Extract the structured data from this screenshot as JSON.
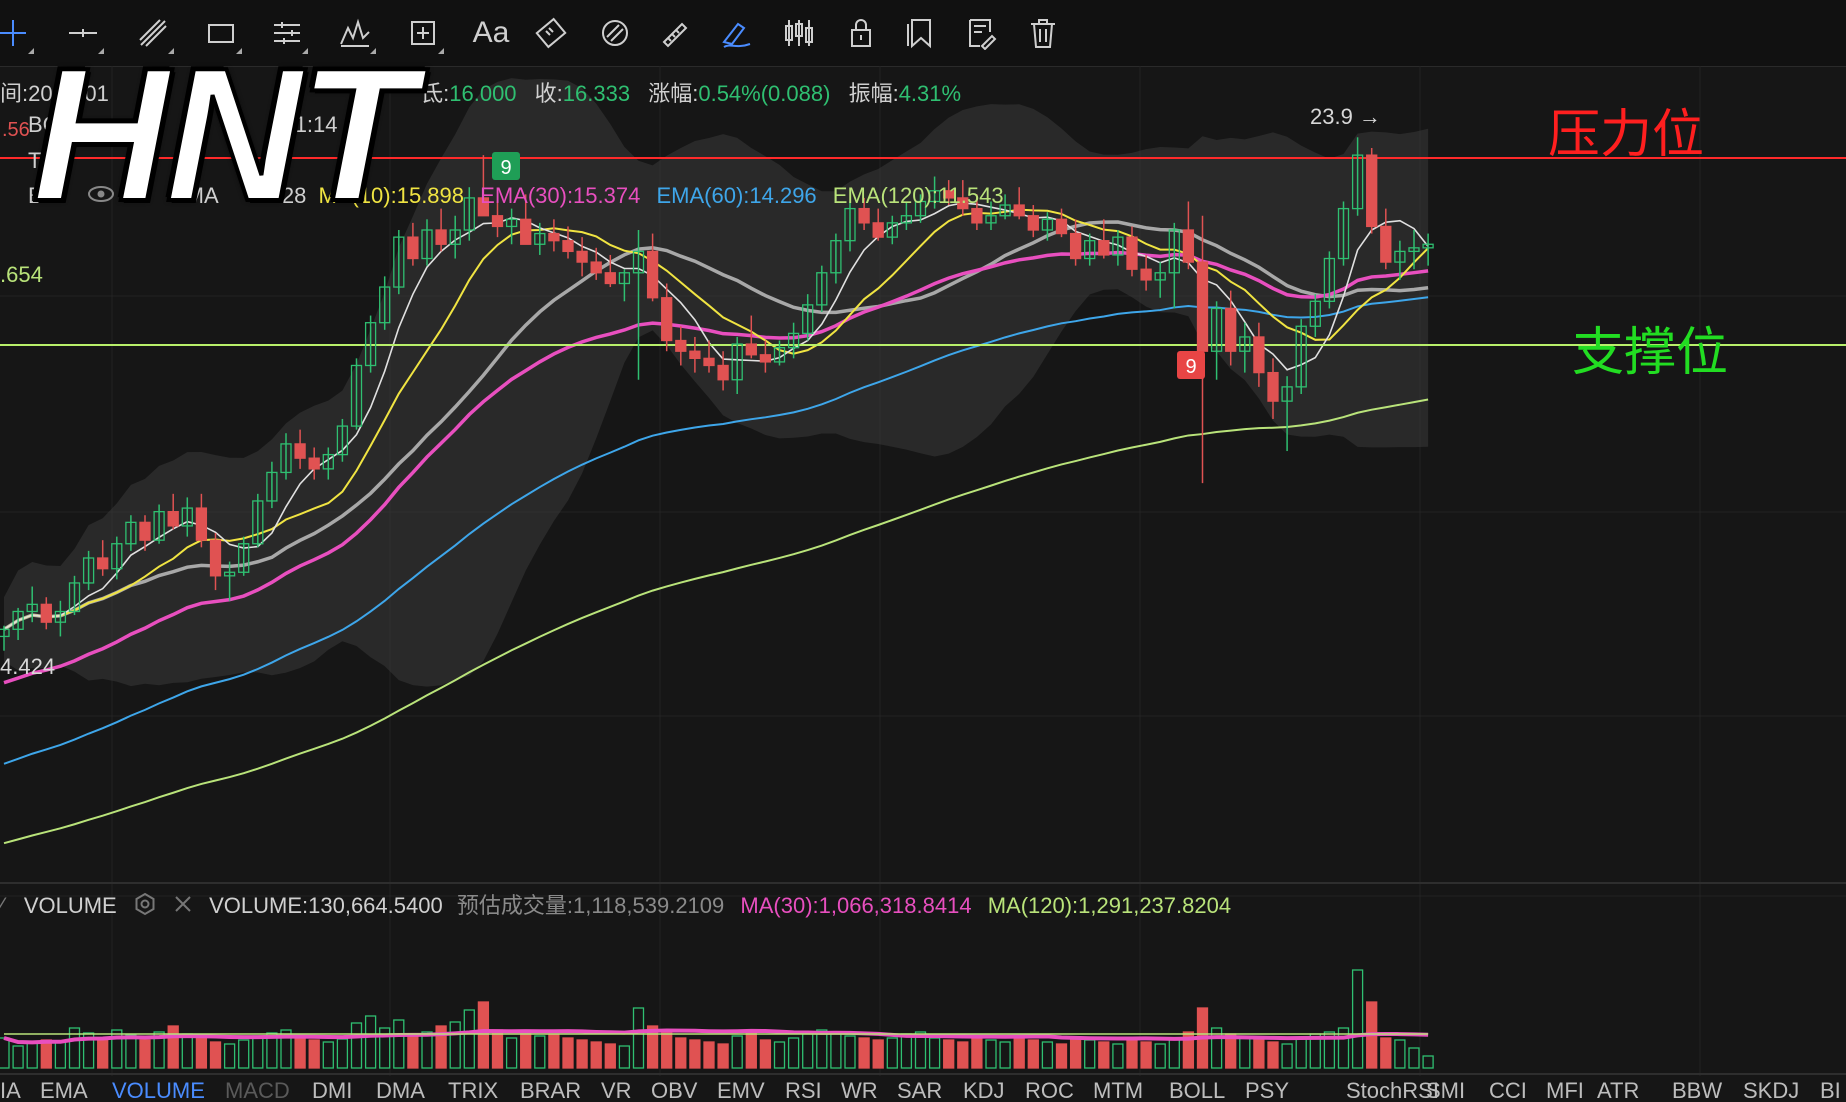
{
  "toolbar": {
    "tools": [
      {
        "name": "crosshair-icon",
        "active": false
      },
      {
        "name": "horizontal-line-icon",
        "active": false
      },
      {
        "name": "trend-line-icon",
        "active": false
      },
      {
        "name": "rectangle-icon",
        "active": false
      },
      {
        "name": "parallel-channel-icon",
        "active": false
      },
      {
        "name": "pattern-icon",
        "active": false
      },
      {
        "name": "measure-box-icon",
        "active": false
      },
      {
        "name": "text-icon",
        "label": "Aa",
        "active": false
      },
      {
        "name": "ruler-icon",
        "active": false
      },
      {
        "name": "eraser-icon",
        "active": false
      },
      {
        "name": "pencil-ruler-icon",
        "active": false
      },
      {
        "name": "draw-pen-icon",
        "active": true
      },
      {
        "name": "candles-icon",
        "active": false
      },
      {
        "name": "lock-icon",
        "active": false
      },
      {
        "name": "copy-icon",
        "active": false
      },
      {
        "name": "edit-note-icon",
        "active": false
      },
      {
        "name": "trash-icon",
        "active": false
      }
    ]
  },
  "overlay": {
    "title": "HNT",
    "pressure_label": "压力位",
    "support_label": "支撑位"
  },
  "info": {
    "time_label": "间:202",
    "time_value": "6-01",
    "low_label": "氐:",
    "low_value": "16.000",
    "close_label": "收:",
    "close_value": "16.333",
    "change_label": "涨幅:",
    "change_value": "0.54%(0.088)",
    "amp_label": "振幅:",
    "amp_value": "4.31%"
  },
  "indicators": {
    "ma10": "MA(10):15.898",
    "ema30": "EMA(30):15.374",
    "ema60": "EMA(60):14.296",
    "ema120": "EMA(120):11.543",
    "ema_partial": "EMA",
    "ema_partial_value": "5.28",
    "boll_partial": "BC",
    "boll_partial_value": "1:14",
    "t_label": "T",
    "e_label": "E"
  },
  "colors": {
    "up": "#2fbf71",
    "down": "#e05252",
    "ma10": "#f0e442",
    "ema30": "#e84fbf",
    "ema60": "#3ea6ea",
    "ema120": "#b9e37a",
    "white_line": "#e0e0e0",
    "grey_line": "#a8a8a8",
    "resistance": "#ff2a2a",
    "support": "#b8ef6a"
  },
  "chart_data": {
    "type": "candlestick",
    "resistance_price": 23.9,
    "support_price": 18.654,
    "price_labels": {
      "high_marker": "23.9 →",
      "left_upper": ".654",
      "left_lower": "4.424",
      "left_red": ".56"
    },
    "badges": [
      {
        "text": "9",
        "color": "red"
      },
      {
        "text": "9",
        "color": "green"
      }
    ],
    "ylim": [
      3.2,
      26.2
    ],
    "candles": [
      [
        10.2,
        10.5,
        9.8,
        10.4
      ],
      [
        10.4,
        11.0,
        10.1,
        10.9
      ],
      [
        10.9,
        11.6,
        10.6,
        11.1
      ],
      [
        11.1,
        11.3,
        10.4,
        10.6
      ],
      [
        10.6,
        11.2,
        10.2,
        10.9
      ],
      [
        10.9,
        11.9,
        10.8,
        11.7
      ],
      [
        11.7,
        12.6,
        11.5,
        12.4
      ],
      [
        12.4,
        12.9,
        11.9,
        12.1
      ],
      [
        12.1,
        13.0,
        11.8,
        12.8
      ],
      [
        12.8,
        13.6,
        12.6,
        13.4
      ],
      [
        13.4,
        13.6,
        12.6,
        12.9
      ],
      [
        12.9,
        13.9,
        12.8,
        13.7
      ],
      [
        13.7,
        14.2,
        13.2,
        13.3
      ],
      [
        13.3,
        14.1,
        13.0,
        13.8
      ],
      [
        13.8,
        14.2,
        12.7,
        12.9
      ],
      [
        12.9,
        13.1,
        11.5,
        11.9
      ],
      [
        11.9,
        12.3,
        11.2,
        12.0
      ],
      [
        12.0,
        13.0,
        11.9,
        12.8
      ],
      [
        12.8,
        14.2,
        12.7,
        14.0
      ],
      [
        14.0,
        15.1,
        13.8,
        14.8
      ],
      [
        14.8,
        15.9,
        14.6,
        15.6
      ],
      [
        15.6,
        16.0,
        14.9,
        15.2
      ],
      [
        15.2,
        15.5,
        14.6,
        14.9
      ],
      [
        14.9,
        15.5,
        14.6,
        15.3
      ],
      [
        15.3,
        16.3,
        15.1,
        16.1
      ],
      [
        16.1,
        18.0,
        16.0,
        17.8
      ],
      [
        17.8,
        19.2,
        17.6,
        19.0
      ],
      [
        19.0,
        20.3,
        18.8,
        20.0
      ],
      [
        20.0,
        21.6,
        19.8,
        21.4
      ],
      [
        21.4,
        21.8,
        20.6,
        20.8
      ],
      [
        20.8,
        21.9,
        20.6,
        21.6
      ],
      [
        21.6,
        22.2,
        21.0,
        21.2
      ],
      [
        21.2,
        22.0,
        20.8,
        21.6
      ],
      [
        21.6,
        22.8,
        21.3,
        22.5
      ],
      [
        22.5,
        23.7,
        22.2,
        22.0
      ],
      [
        22.0,
        22.4,
        21.4,
        21.7
      ],
      [
        21.7,
        22.2,
        21.2,
        21.9
      ],
      [
        21.9,
        22.6,
        21.6,
        21.2
      ],
      [
        21.2,
        21.8,
        20.9,
        21.5
      ],
      [
        21.5,
        21.9,
        21.0,
        21.3
      ],
      [
        21.3,
        21.7,
        20.8,
        21.0
      ],
      [
        21.0,
        21.4,
        20.3,
        20.7
      ],
      [
        20.7,
        21.1,
        20.2,
        20.4
      ],
      [
        20.4,
        20.9,
        20.0,
        20.1
      ],
      [
        20.1,
        20.5,
        19.6,
        20.4
      ],
      [
        20.4,
        21.6,
        17.4,
        21.0
      ],
      [
        21.0,
        21.5,
        19.6,
        19.7
      ],
      [
        19.7,
        20.1,
        18.2,
        18.5
      ],
      [
        18.5,
        18.9,
        17.8,
        18.2
      ],
      [
        18.2,
        18.6,
        17.6,
        18.0
      ],
      [
        18.0,
        18.5,
        17.6,
        17.8
      ],
      [
        17.8,
        18.2,
        17.1,
        17.4
      ],
      [
        17.4,
        18.6,
        17.0,
        18.4
      ],
      [
        18.4,
        19.2,
        18.0,
        18.1
      ],
      [
        18.1,
        18.5,
        17.6,
        17.9
      ],
      [
        17.9,
        18.5,
        17.8,
        18.3
      ],
      [
        18.3,
        19.0,
        18.0,
        18.7
      ],
      [
        18.7,
        19.8,
        18.5,
        19.5
      ],
      [
        19.5,
        20.6,
        19.3,
        20.4
      ],
      [
        20.4,
        21.5,
        20.1,
        21.3
      ],
      [
        21.3,
        22.4,
        21.0,
        22.2
      ],
      [
        22.2,
        22.5,
        21.6,
        21.8
      ],
      [
        21.8,
        22.2,
        21.3,
        21.4
      ],
      [
        21.4,
        22.0,
        21.2,
        21.8
      ],
      [
        21.8,
        22.4,
        21.6,
        22.0
      ],
      [
        22.0,
        22.6,
        21.8,
        22.4
      ],
      [
        22.4,
        23.1,
        22.2,
        22.7
      ],
      [
        22.7,
        23.0,
        22.3,
        22.5
      ],
      [
        22.5,
        23.0,
        22.0,
        22.2
      ],
      [
        22.2,
        22.6,
        21.6,
        21.8
      ],
      [
        21.8,
        22.4,
        21.6,
        22.0
      ],
      [
        22.0,
        22.6,
        21.9,
        22.3
      ],
      [
        22.3,
        22.8,
        21.9,
        22.0
      ],
      [
        22.0,
        22.3,
        21.4,
        21.6
      ],
      [
        21.6,
        22.1,
        21.3,
        21.9
      ],
      [
        21.9,
        22.2,
        21.4,
        21.5
      ],
      [
        21.5,
        21.9,
        20.6,
        20.8
      ],
      [
        20.8,
        21.5,
        20.6,
        21.3
      ],
      [
        21.3,
        21.9,
        20.8,
        20.9
      ],
      [
        20.9,
        21.6,
        20.6,
        21.4
      ],
      [
        21.4,
        21.7,
        20.3,
        20.5
      ],
      [
        20.5,
        20.9,
        19.9,
        20.2
      ],
      [
        20.2,
        20.7,
        19.7,
        20.4
      ],
      [
        20.4,
        21.8,
        19.4,
        21.6
      ],
      [
        21.6,
        22.4,
        20.5,
        20.7
      ],
      [
        20.7,
        22.0,
        14.5,
        18.2
      ],
      [
        18.2,
        19.6,
        17.4,
        19.4
      ],
      [
        19.4,
        19.9,
        17.8,
        18.2
      ],
      [
        18.2,
        19.0,
        17.6,
        18.6
      ],
      [
        18.6,
        19.0,
        17.2,
        17.6
      ],
      [
        17.6,
        18.0,
        16.3,
        16.8
      ],
      [
        16.8,
        17.5,
        15.4,
        17.2
      ],
      [
        17.2,
        19.1,
        17.0,
        18.9
      ],
      [
        18.9,
        19.8,
        18.6,
        19.6
      ],
      [
        19.6,
        21.0,
        19.4,
        20.8
      ],
      [
        20.8,
        22.4,
        20.6,
        22.2
      ],
      [
        22.2,
        24.2,
        22.0,
        23.7
      ],
      [
        23.7,
        23.9,
        21.5,
        21.7
      ],
      [
        21.7,
        22.2,
        20.5,
        20.7
      ],
      [
        20.7,
        21.3,
        20.2,
        21.0
      ],
      [
        21.0,
        21.6,
        20.5,
        21.1
      ],
      [
        21.1,
        21.5,
        20.6,
        21.2
      ]
    ],
    "volumes": [
      30,
      22,
      25,
      28,
      26,
      40,
      35,
      30,
      38,
      33,
      28,
      36,
      42,
      34,
      30,
      26,
      24,
      28,
      32,
      35,
      38,
      30,
      28,
      26,
      29,
      45,
      52,
      40,
      48,
      34,
      36,
      42,
      46,
      58,
      66,
      38,
      30,
      36,
      32,
      34,
      30,
      28,
      26,
      24,
      22,
      60,
      42,
      38,
      30,
      28,
      26,
      24,
      32,
      36,
      28,
      26,
      30,
      34,
      38,
      36,
      32,
      30,
      28,
      30,
      34,
      36,
      30,
      28,
      26,
      30,
      28,
      26,
      30,
      28,
      26,
      24,
      30,
      28,
      26,
      24,
      28,
      26,
      24,
      30,
      36,
      60,
      40,
      34,
      30,
      28,
      26,
      24,
      30,
      34,
      36,
      40,
      98,
      66,
      30,
      28,
      20,
      12
    ],
    "volume_ma30": 30,
    "volume_ma120": 34
  },
  "volume": {
    "title": "VOLUME",
    "value": "VOLUME:130,664.5400",
    "est_label": "预估成交量:",
    "est_value": "1,118,539.2109",
    "ma30": "MA(30):1,066,318.8414",
    "ma120": "MA(120):1,291,237.8204"
  },
  "bottom_tabs": [
    "IA",
    "EMA",
    "VOLUME",
    "MACD",
    "DMI",
    "DMA",
    "TRIX",
    "BRAR",
    "VR",
    "OBV",
    "EMV",
    "RSI",
    "WR",
    "SAR",
    "KDJ",
    "ROC",
    "MTM",
    "BOLL",
    "PSY",
    "StochRSI",
    "SMI",
    "CCI",
    "MFI",
    "ATR",
    "BBW",
    "SKDJ",
    "BI"
  ],
  "bottom_tab_active": "VOLUME",
  "bottom_tab_dim": "MACD"
}
